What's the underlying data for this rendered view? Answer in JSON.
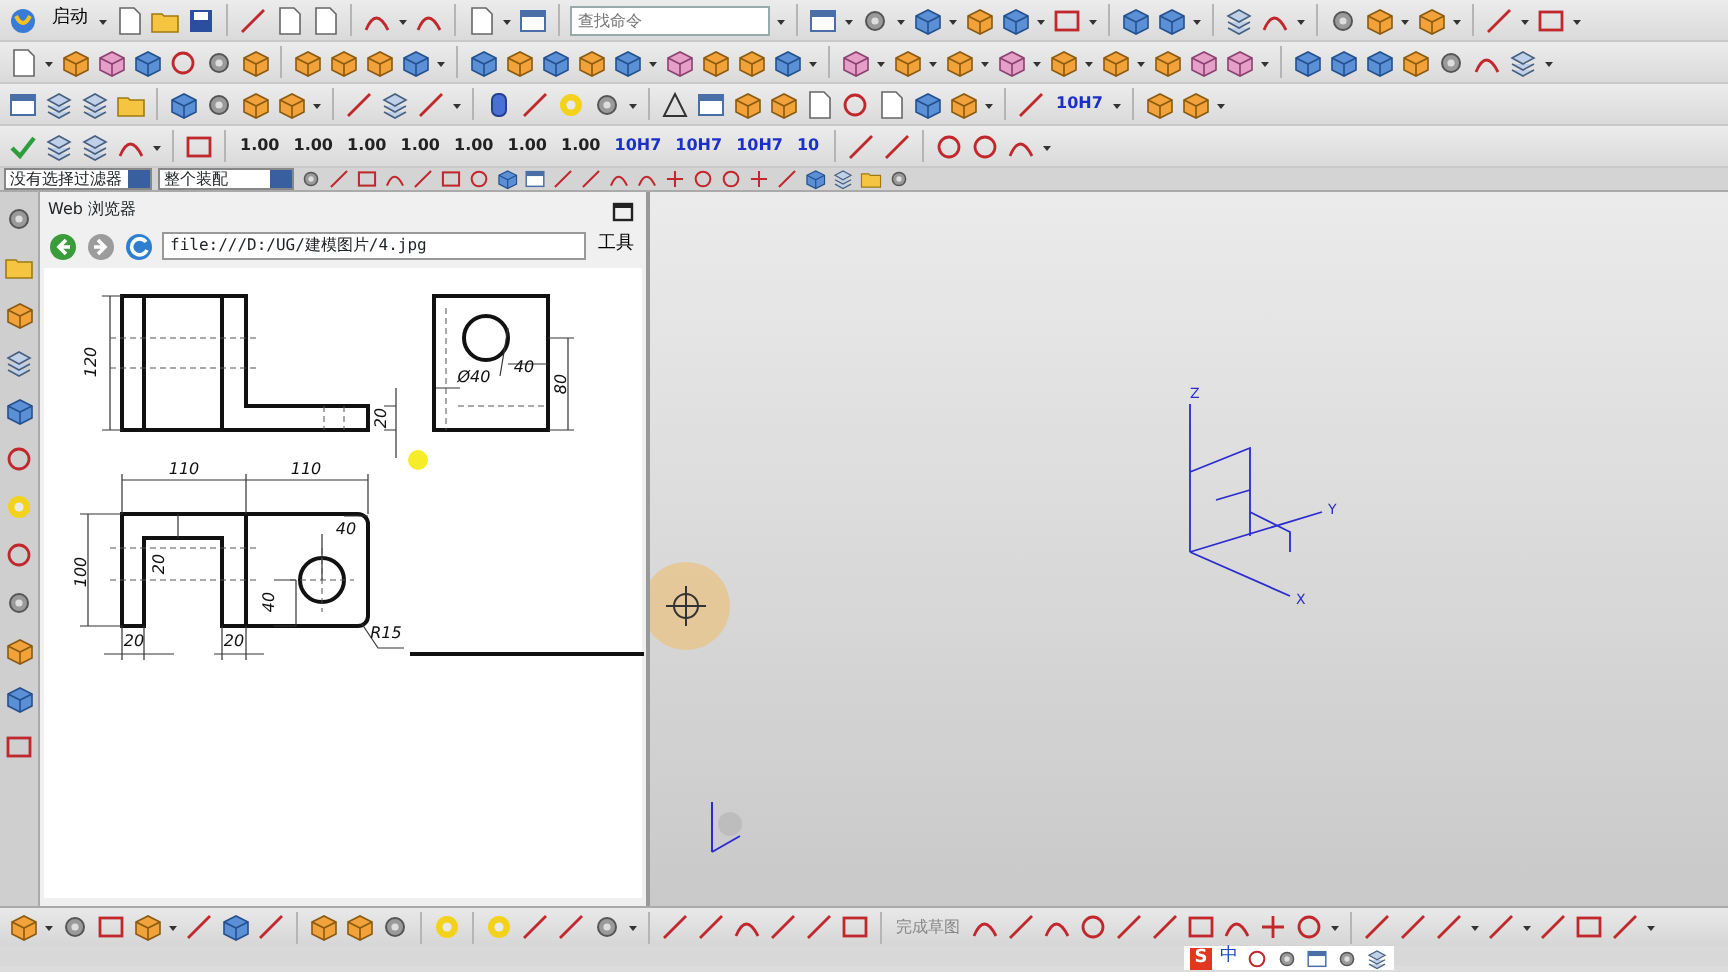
{
  "main_toolbar": {
    "start_label": "启动",
    "search_placeholder": "查找命令"
  },
  "dimension_toolbar": {
    "labels": [
      "1.00",
      "1.00",
      "1.00",
      "1.00",
      "1.00",
      "1.00",
      "1.00",
      "10H7",
      "10H7",
      "10H7",
      "10"
    ],
    "measure_label": "10H7"
  },
  "selection_bar": {
    "filter": "没有选择过滤器",
    "scope": "整个装配"
  },
  "web_browser": {
    "title": "Web 浏览器",
    "url": "file:///D:/UG/建模图片/4.jpg",
    "tools_label": "工具",
    "drawing_labels": [
      "120",
      "20",
      "Ø40",
      "40",
      "80",
      "110",
      "110",
      "20",
      "100",
      "40",
      "40",
      "20",
      "20",
      "R15"
    ]
  },
  "viewport": {
    "axes": [
      "Z",
      "Y",
      "X"
    ]
  },
  "sketch_toolbar": {
    "finish_sketch": "完成草图"
  },
  "ime_bar": {
    "logo": "S",
    "mode": "中"
  }
}
